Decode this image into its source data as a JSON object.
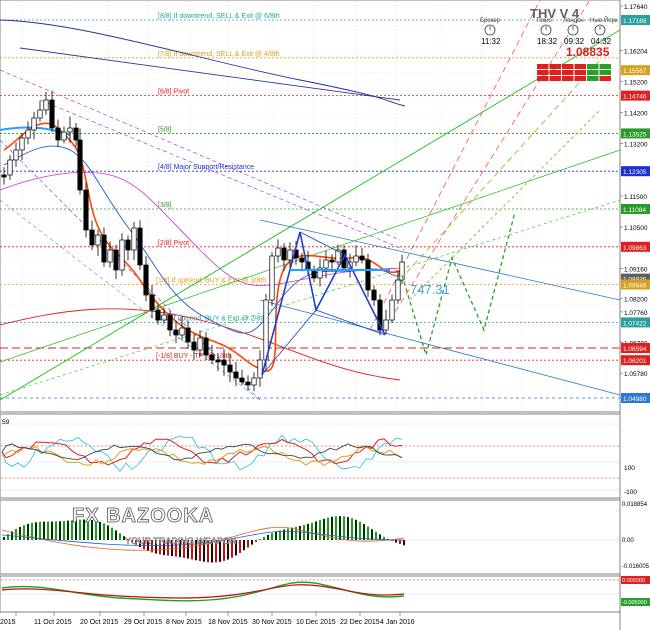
{
  "chart_data": {
    "type": "candlestick",
    "title": "THV V 4",
    "price_current": "1.08835",
    "price_axis_ticks": [
      "1.17640",
      "1.17188",
      "1.16204",
      "1.15567",
      "1.15200",
      "1.14746",
      "1.14200",
      "1.13525",
      "1.13200",
      "1.12305",
      "1.11500",
      "1.11084",
      "1.10500",
      "1.09863",
      "1.09160",
      "1.08835",
      "1.08646",
      "1.08200",
      "1.07760",
      "1.07422",
      "1.06780",
      "1.06594",
      "1.06201",
      "1.05780",
      "1.04980"
    ],
    "price_axis_highlights": [
      {
        "value": "1.17188",
        "color": "#2aa0a0"
      },
      {
        "value": "1.15567",
        "color": "#d8a020"
      },
      {
        "value": "1.14746",
        "color": "#e02020"
      },
      {
        "value": "1.13525",
        "color": "#2a9a2a"
      },
      {
        "value": "1.12305",
        "color": "#2030d0"
      },
      {
        "value": "1.11084",
        "color": "#2a9a2a"
      },
      {
        "value": "1.09863",
        "color": "#e02020"
      },
      {
        "value": "1.08835",
        "color": "#606060"
      },
      {
        "value": "1.08646",
        "color": "#d8a020"
      },
      {
        "value": "1.07422",
        "color": "#2aa0a0"
      },
      {
        "value": "1.06594",
        "color": "#e02020"
      },
      {
        "value": "1.06201",
        "color": "#e02020"
      },
      {
        "value": "1.04980",
        "color": "#2a7ad0"
      }
    ],
    "x_tick_labels": [
      "2015",
      "11 Oct 2015",
      "20 Oct 2015",
      "29 Oct 2015",
      "8 Nov 2015",
      "18 Nov 2015",
      "30 Nov 2015",
      "10 Dec 2015",
      "22 Dec 2015",
      "4 Jan 2016"
    ],
    "murrey_levels": [
      {
        "label": "[8/8] If downtrend, SELL & Exit @ 6/8th",
        "price": 1.17188,
        "color": "#2aa0a0"
      },
      {
        "label": "[7/8] If downtrend, SELL & Exit @ 4/8th",
        "price": 1.15967,
        "color": "#d8a020"
      },
      {
        "label": "[6/8] Pivot",
        "price": 1.14746,
        "color": "#e02020"
      },
      {
        "label": "[5/8]",
        "price": 1.13525,
        "color": "#2a9a2a"
      },
      {
        "label": "[4/8] Major Support/Resistance",
        "price": 1.12305,
        "color": "#2030d0"
      },
      {
        "label": "[3/8]",
        "price": 1.11084,
        "color": "#2a9a2a"
      },
      {
        "label": "[2/8] Pivot",
        "price": 1.09863,
        "color": "#e02020"
      },
      {
        "label": "[1/8] If uptrend, BUY & Exit @ 3/8th",
        "price": 1.08646,
        "color": "#d8a020"
      },
      {
        "label": "[0/8] If uptrend, BUY & Exit @ 2/8th",
        "price": 1.07422,
        "color": "#2aa0a0"
      },
      {
        "label": "[-1/8] BUY - TP: @ 1/8th",
        "price": 1.06201,
        "color": "#e02020"
      }
    ],
    "pattern_label": "747.31",
    "clock_labels": [
      "Брокер",
      "Токио",
      "Лондон",
      "Нью-Йорк"
    ],
    "clock_times": [
      "11:32",
      "18:32",
      "09:32",
      "04:32"
    ],
    "watermark_line1": "FX BAZOOKA",
    "watermark_line2": "YOUR TRADING WEAPON",
    "osc1_ticks": [
      "100",
      "59",
      "-100"
    ],
    "osc2_ticks": [
      "0.018854",
      "0.00",
      "-0.016005"
    ],
    "osc3_ticks": [
      "0.005000",
      "-0.005000"
    ]
  }
}
